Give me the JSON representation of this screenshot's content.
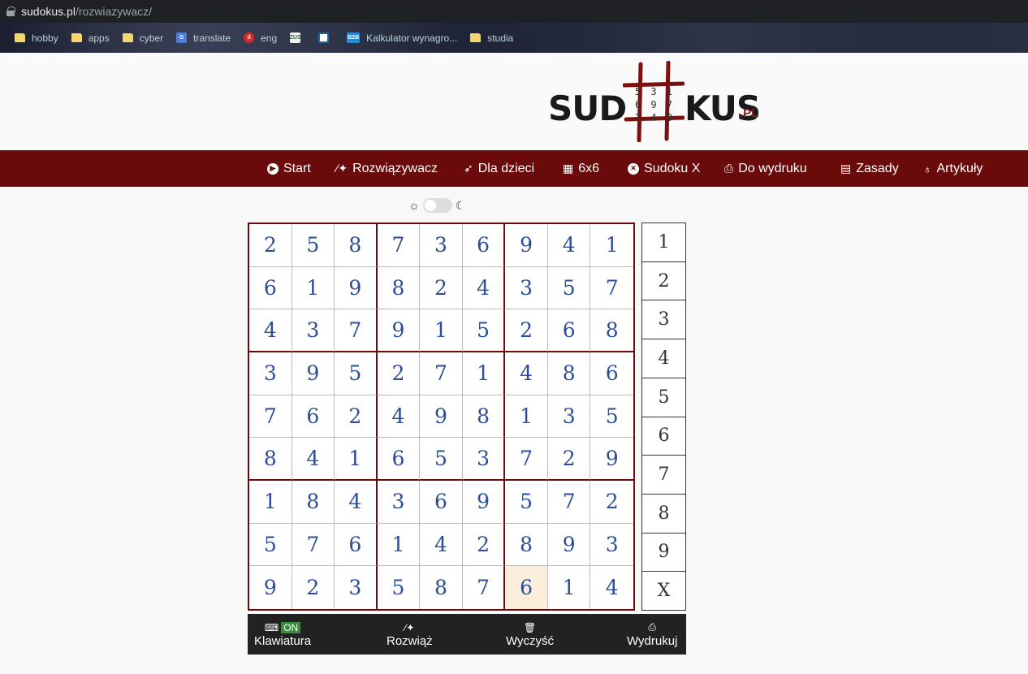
{
  "browser": {
    "url_domain": "sudokus.pl",
    "url_path": "/rozwiazywacz/",
    "bookmarks": [
      {
        "label": "hobby",
        "icon": "folder-icon"
      },
      {
        "label": "apps",
        "icon": "folder-icon"
      },
      {
        "label": "cyber",
        "icon": "folder-icon"
      },
      {
        "label": "translate",
        "icon": "google-translate-icon"
      },
      {
        "label": "eng",
        "icon": "diki-icon"
      },
      {
        "label": "",
        "icon": "zus-icon"
      },
      {
        "label": "",
        "icon": "grid-app-icon"
      },
      {
        "label": "Kalkulator wynagro...",
        "icon": "b2b-icon"
      },
      {
        "label": "studia",
        "icon": "folder-icon"
      }
    ]
  },
  "logo": {
    "left": "SUD",
    "right": "KUS",
    "suffix": ".PL",
    "mini_digits": [
      "5",
      "3",
      "1",
      "6",
      "9",
      "7",
      "2",
      "4",
      "8"
    ]
  },
  "nav": {
    "items": [
      {
        "label": "Start",
        "icon": "play-circle-icon"
      },
      {
        "label": "Rozwiązywacz",
        "icon": "magic-wand-icon"
      },
      {
        "label": "Dla dzieci",
        "icon": "rocket-icon"
      },
      {
        "label": "6x6",
        "icon": "grid-icon"
      },
      {
        "label": "Sudoku X",
        "icon": "x-circle-icon"
      },
      {
        "label": "Do wydruku",
        "icon": "printer-icon"
      },
      {
        "label": "Zasady",
        "icon": "document-icon"
      },
      {
        "label": "Artykuły",
        "icon": "lightbulb-icon"
      }
    ]
  },
  "theme_toggle": {
    "state": "light"
  },
  "board": {
    "rows": [
      [
        "2",
        "5",
        "8",
        "7",
        "3",
        "6",
        "9",
        "4",
        "1"
      ],
      [
        "6",
        "1",
        "9",
        "8",
        "2",
        "4",
        "3",
        "5",
        "7"
      ],
      [
        "4",
        "3",
        "7",
        "9",
        "1",
        "5",
        "2",
        "6",
        "8"
      ],
      [
        "3",
        "9",
        "5",
        "2",
        "7",
        "1",
        "4",
        "8",
        "6"
      ],
      [
        "7",
        "6",
        "2",
        "4",
        "9",
        "8",
        "1",
        "3",
        "5"
      ],
      [
        "8",
        "4",
        "1",
        "6",
        "5",
        "3",
        "7",
        "2",
        "9"
      ],
      [
        "1",
        "8",
        "4",
        "3",
        "6",
        "9",
        "5",
        "7",
        "2"
      ],
      [
        "5",
        "7",
        "6",
        "1",
        "4",
        "2",
        "8",
        "9",
        "3"
      ],
      [
        "9",
        "2",
        "3",
        "5",
        "8",
        "7",
        "6",
        "1",
        "4"
      ]
    ],
    "selected": {
      "row": 8,
      "col": 6
    },
    "colors": {
      "digit": "#2a4d9a",
      "border": "#6b0a0a",
      "selected_bg": "#fbeedb"
    }
  },
  "numpad": [
    "1",
    "2",
    "3",
    "4",
    "5",
    "6",
    "7",
    "8",
    "9",
    "X"
  ],
  "toolbar": {
    "keyboard_label": "Klawiatura",
    "keyboard_badge": "ON",
    "solve_label": "Rozwiąż",
    "clear_label": "Wyczyść",
    "print_label": "Wydrukuj"
  },
  "colors": {
    "nav_bg": "#6b0a0a",
    "toolbar_bg": "#222222"
  }
}
